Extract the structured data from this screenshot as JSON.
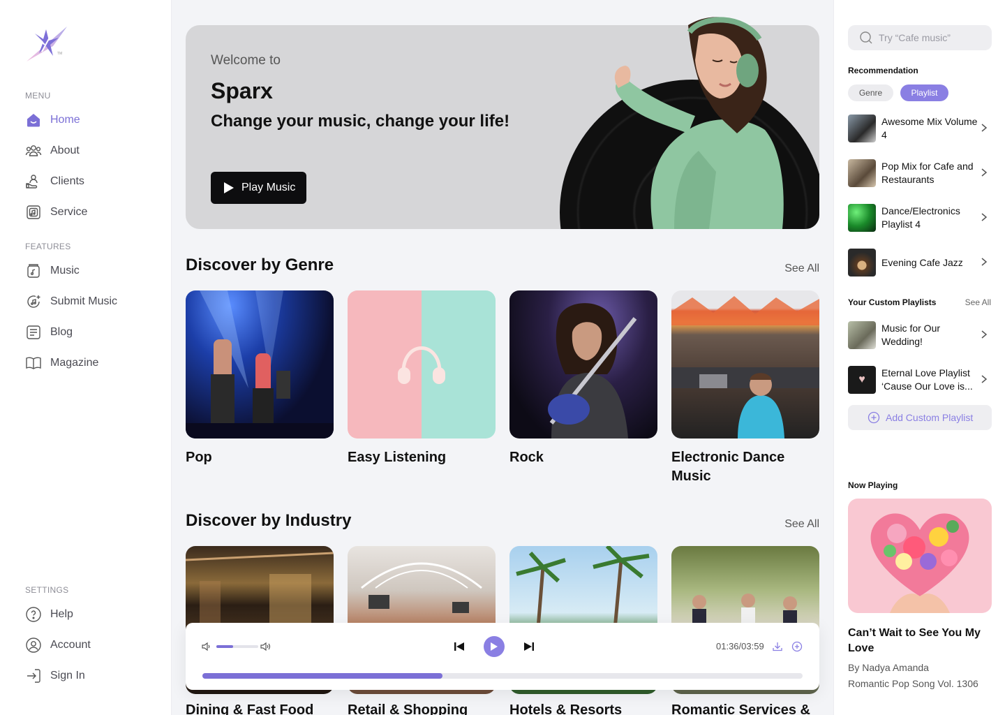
{
  "sidebar": {
    "menu_label": "MENU",
    "features_label": "FEATURES",
    "settings_label": "SETTINGS",
    "menu": [
      {
        "label": "Home",
        "icon": "home-icon"
      },
      {
        "label": "About",
        "icon": "people-icon"
      },
      {
        "label": "Clients",
        "icon": "clients-icon"
      },
      {
        "label": "Service",
        "icon": "service-icon"
      }
    ],
    "features": [
      {
        "label": "Music",
        "icon": "music-icon"
      },
      {
        "label": "Submit Music",
        "icon": "submit-music-icon"
      },
      {
        "label": "Blog",
        "icon": "blog-icon"
      },
      {
        "label": "Magazine",
        "icon": "book-icon"
      }
    ],
    "settings": [
      {
        "label": "Help",
        "icon": "help-icon"
      },
      {
        "label": "Account",
        "icon": "account-icon"
      },
      {
        "label": "Sign In",
        "icon": "sign-in-icon"
      }
    ]
  },
  "hero": {
    "welcome": "Welcome to",
    "brand": "Sparx",
    "tagline": "Change your music, change your life!",
    "button": "Play Music"
  },
  "genre": {
    "title": "Discover by Genre",
    "see_all": "See All",
    "items": [
      "Pop",
      "Easy Listening",
      "Rock",
      "Electronic Dance Music"
    ]
  },
  "industry": {
    "title": "Discover by Industry",
    "see_all": "See All",
    "items": [
      "Dining & Fast Food",
      "Retail & Shopping",
      "Hotels & Resorts",
      "Romantic Services &"
    ]
  },
  "player": {
    "time": "01:36/03:59",
    "progress": 0.4,
    "volume": 0.4
  },
  "right": {
    "search_placeholder": "Try “Cafe music”",
    "recommendation_label": "Recommendation",
    "chips": [
      "Genre",
      "Playlist"
    ],
    "recommendations": [
      "Awesome Mix Volume 4",
      "Pop Mix for Cafe and Restaurants",
      "Dance/Electronics Playlist 4",
      "Evening Cafe Jazz"
    ],
    "custom_label": "Your Custom Playlists",
    "custom_see_all": "See All",
    "custom": [
      "Music for Our Wedding!",
      "Eternal Love Playlist ‘Cause Our Love is..."
    ],
    "add_playlist": "Add Custom Playlist",
    "now_playing_label": "Now Playing",
    "now_playing": {
      "title": "Can’t Wait to See You My Love",
      "artist": "By Nadya Amanda",
      "album": "Romantic Pop Song Vol. 1306"
    }
  },
  "colors": {
    "accent": "#8a7fe3",
    "active": "#7b6fd6"
  }
}
